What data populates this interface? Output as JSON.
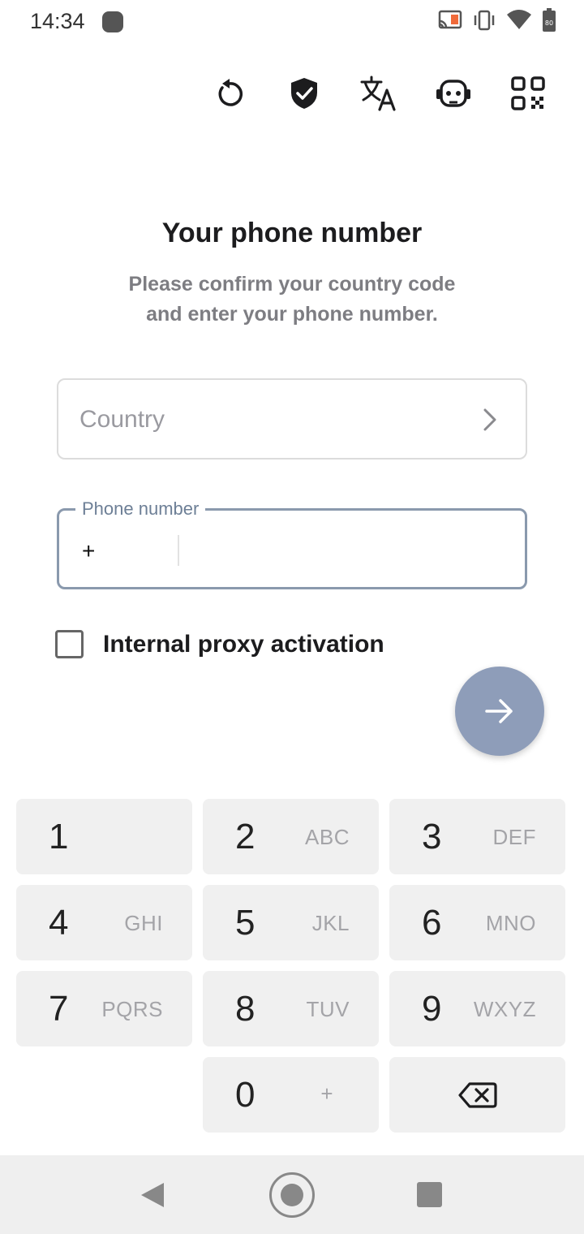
{
  "status_bar": {
    "time": "14:34",
    "battery_level": "80",
    "icons": [
      "cast-icon",
      "vibrate-icon",
      "wifi-icon",
      "battery-icon"
    ]
  },
  "toolbar": {
    "icons": [
      "refresh-icon",
      "shield-check-icon",
      "translate-icon",
      "bot-icon",
      "qr-code-icon"
    ]
  },
  "main": {
    "title": "Your phone number",
    "subtitle_line1": "Please confirm your country code",
    "subtitle_line2": "and enter your phone number.",
    "country_placeholder": "Country",
    "phone_label": "Phone number",
    "phone_prefix": "+",
    "phone_value": "",
    "proxy_label": "Internal proxy activation",
    "proxy_checked": false
  },
  "keypad": {
    "keys": [
      {
        "digit": "1",
        "letters": ""
      },
      {
        "digit": "2",
        "letters": "ABC"
      },
      {
        "digit": "3",
        "letters": "DEF"
      },
      {
        "digit": "4",
        "letters": "GHI"
      },
      {
        "digit": "5",
        "letters": "JKL"
      },
      {
        "digit": "6",
        "letters": "MNO"
      },
      {
        "digit": "7",
        "letters": "PQRS"
      },
      {
        "digit": "8",
        "letters": "TUV"
      },
      {
        "digit": "9",
        "letters": "WXYZ"
      },
      {
        "digit": "0",
        "letters": "+"
      }
    ]
  },
  "colors": {
    "accent": "#8e9db9",
    "field_border_active": "#8a99ad",
    "key_background": "#f0f0f0"
  }
}
